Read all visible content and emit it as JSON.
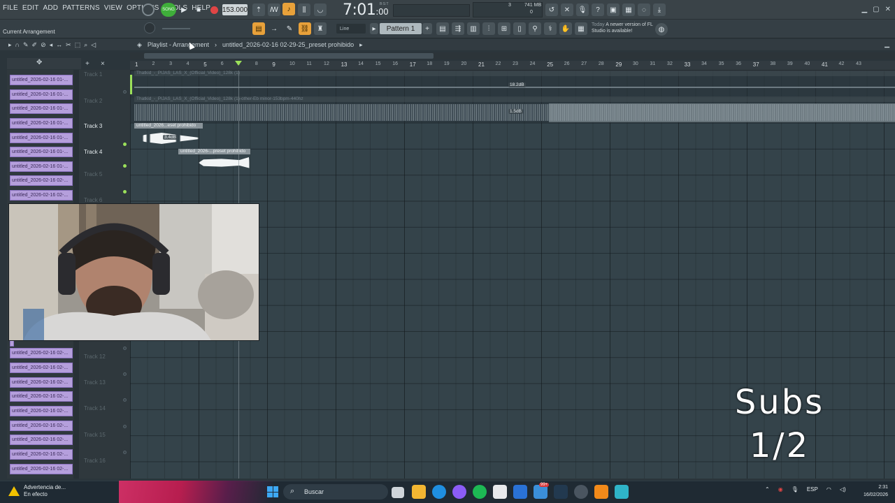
{
  "menu": [
    "FILE",
    "EDIT",
    "ADD",
    "PATTERNS",
    "VIEW",
    "OPTIONS",
    "TOOLS",
    "HELP"
  ],
  "transport": {
    "song_label": "SONG",
    "tempo": "153.000",
    "time_main": "7:01",
    "time_sub": ":00",
    "bst": "B:S:T"
  },
  "system": {
    "memory": "741 MB",
    "cpu_value": "3",
    "poly": "0"
  },
  "toolbar": {
    "current_arrangement": "Current Arrangement",
    "snap_mode": "Line",
    "pattern": "Pattern 1"
  },
  "news": {
    "today": "Today",
    "message": "A newer version of FL Studio is available!"
  },
  "playlist": {
    "title": "Playlist - Arrangement",
    "separator": "›",
    "arrangement_name": "untitled_2026-02-16 02-29-25_preset prohibido"
  },
  "ruler": {
    "bars": [
      "1",
      "2",
      "3",
      "4",
      "5",
      "6",
      "7",
      "8",
      "9",
      "10",
      "11",
      "12",
      "13",
      "14",
      "15",
      "16",
      "17",
      "18",
      "19",
      "20",
      "21",
      "22",
      "23",
      "24",
      "25",
      "26",
      "27",
      "28",
      "29",
      "30",
      "31",
      "32",
      "33",
      "34",
      "35",
      "36",
      "37",
      "38",
      "39",
      "40",
      "41",
      "42",
      "43"
    ],
    "major": [
      "1",
      "5",
      "9",
      "13",
      "17",
      "21",
      "25",
      "29",
      "33",
      "37",
      "41"
    ]
  },
  "picker": {
    "items": [
      "untitled_2026-02-16 01-...",
      "untitled_2026-02-16 01-...",
      "untitled_2026-02-16 01-...",
      "untitled_2026-02-16 01-...",
      "untitled_2026-02-16 01-...",
      "untitled_2026-02-16 01-...",
      "untitled_2026-02-16 01-...",
      "untitled_2026-02-16 02-...",
      "untitled_2026-02-16 02-...",
      "untitled_2026-02-16 02-...",
      "untitled_2026-02-16 02-...",
      "untitled_2026-02-16 02-...",
      "untitled_2026-02-16 02-...",
      "untitled_2026-02-16 02-...",
      "untitled_2026-02-16 02-...",
      "untitled_2026-02-16 02-...",
      "untitled_2026-02-16 02-...",
      "untitled_2026-02-16 02-..."
    ]
  },
  "tracks": {
    "track1": "Track 1",
    "track2": "Track 2",
    "track3": "Track 3",
    "track4": "Track 4",
    "track5": "Track 5",
    "track6": "Track 6",
    "track12": "Track 12",
    "track13": "Track 13",
    "track14": "Track 14",
    "track15": "Track 15",
    "track16": "Track 16"
  },
  "clips": {
    "clip1": {
      "name": "Thatkid_-_PIJAS_LAS_X_(Official_Video)_128k (1)",
      "gain": "18.2dB"
    },
    "clip2": {
      "name": "Thatkid_-_PIJAS_LAS_X_(Official_Video)_128k (1)-other-Eb minor-153bpm-440hz",
      "gain": "1.5dB"
    },
    "clip3": {
      "name": "untitled_2026...eset prohibido",
      "gain": "3.4dB"
    },
    "clip4": {
      "name": "untitled_2026-...preset prohibido"
    }
  },
  "overlay": {
    "line1": "Subs",
    "line2": "1/2"
  },
  "taskbar": {
    "warning_title": "Advertencia de...",
    "warning_sub": "En efecto",
    "search_placeholder": "Buscar",
    "mail_badge": "99+",
    "lang": "ESP",
    "time": "2:31",
    "date": "16/02/2026"
  },
  "colors": {
    "accent_green": "#9be05a",
    "clip_purple": "#b59fdc",
    "grid_bg": "#34434a",
    "record_red": "#e04545"
  }
}
